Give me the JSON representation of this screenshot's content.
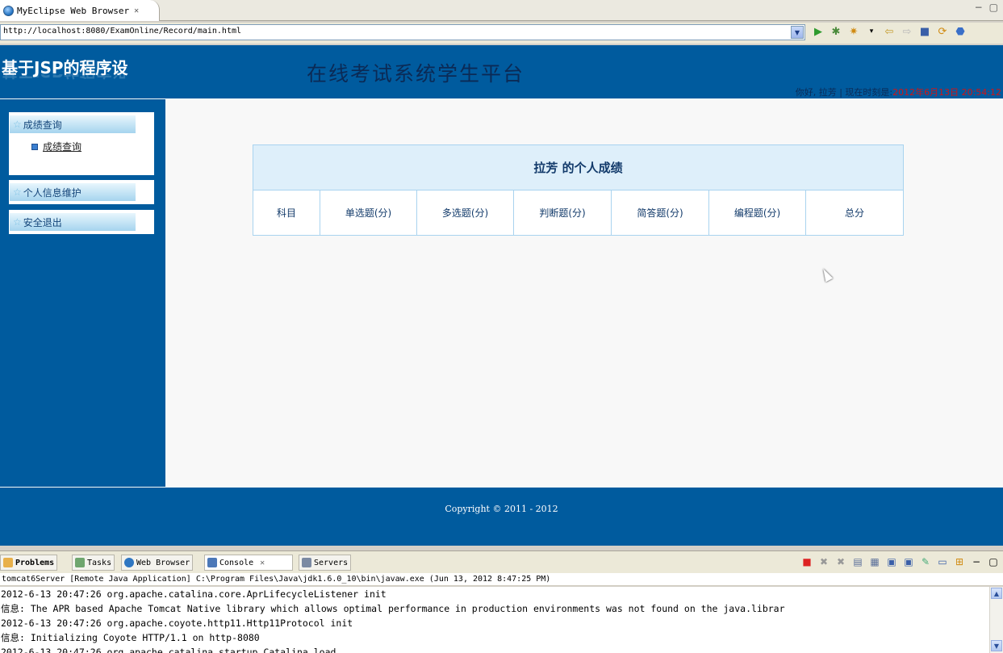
{
  "editor_tab": {
    "label": "MyEclipse Web Browser"
  },
  "address": {
    "url": "http://localhost:8080/ExamOnline/Record/main.html"
  },
  "site": {
    "logo": "基于JSP的程序设",
    "title": "在线考试系统学生平台",
    "welcome_prefix": "你好, 拉芳 | 现在时刻是:",
    "time": "2012年6月13日 20:54:12"
  },
  "sidebar": {
    "groups": [
      {
        "label": "成绩查询",
        "subitems": [
          {
            "label": "成绩查询"
          }
        ]
      },
      {
        "label": "个人信息维护"
      },
      {
        "label": "安全退出"
      }
    ]
  },
  "grade_table": {
    "heading": "拉芳 的个人成绩",
    "columns": [
      "科目",
      "单选题(分)",
      "多选题(分)",
      "判断题(分)",
      "简答题(分)",
      "编程题(分)",
      "总分"
    ]
  },
  "footer": {
    "copyright": "Copyright © 2011 - 2012"
  },
  "view_tabs": [
    "Problems",
    "Tasks",
    "Web Browser",
    "Console",
    "Servers"
  ],
  "console": {
    "header": "tomcat6Server [Remote Java Application] C:\\Program Files\\Java\\jdk1.6.0_10\\bin\\javaw.exe (Jun 13, 2012 8:47:25 PM)",
    "lines": [
      "2012-6-13 20:47:26 org.apache.catalina.core.AprLifecycleListener init",
      "信息: The APR based Apache Tomcat Native library which allows optimal performance in production environments was not found on the java.librar",
      "2012-6-13 20:47:26 org.apache.coyote.http11.Http11Protocol init",
      "信息: Initializing Coyote HTTP/1.1 on http-8080",
      "2012-6-13 20:47:26 org.apache.catalina.startup.Catalina load"
    ]
  },
  "colors": {
    "header_blue": "#005b9e",
    "table_border": "#a9d3ef",
    "time_red": "#d21414"
  }
}
